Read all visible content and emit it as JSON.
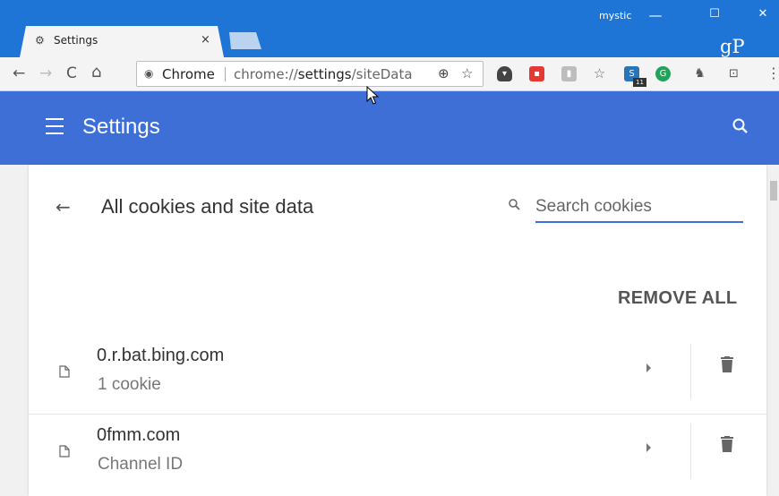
{
  "browser": {
    "tab_title": "Settings",
    "tab_close": "×",
    "profile_name": "mystic",
    "window_min": "—",
    "window_max": "☐",
    "window_close": "✕",
    "logo": "gP",
    "address_chip": "Chrome",
    "url_scheme": "chrome://",
    "url_host": "settings",
    "url_path": "/siteData"
  },
  "extensions": {
    "badge_count": "11"
  },
  "settings": {
    "title": "Settings"
  },
  "page": {
    "title": "All cookies and site data",
    "search_placeholder": "Search cookies",
    "remove_all_label": "REMOVE ALL"
  },
  "sites": [
    {
      "name": "0.r.bat.bing.com",
      "detail": "1 cookie"
    },
    {
      "name": "0fmm.com",
      "detail": "Channel ID"
    }
  ],
  "colors": {
    "titlebar": "#1e75d6",
    "appbar": "#3d6fd7",
    "accent": "#3d6fd7"
  }
}
